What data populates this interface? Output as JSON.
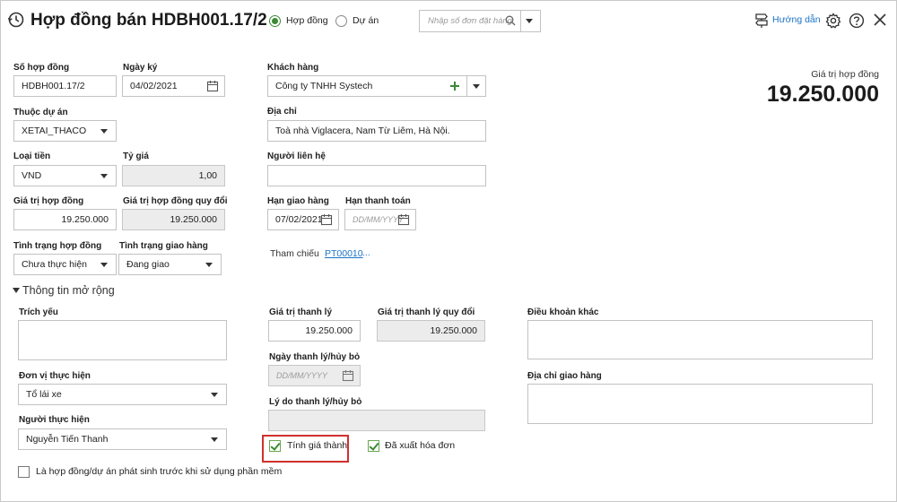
{
  "header": {
    "title": "Hợp đồng bán HDBH001.17/2",
    "radio_contract": "Hợp đồng",
    "radio_project": "Dự án",
    "search_placeholder": "Nhập số đơn đặt hàng",
    "guide_label": "Hướng dẫn"
  },
  "summary": {
    "contract_value_label": "Giá trị hợp đồng",
    "contract_value": "19.250.000"
  },
  "form": {
    "contract_no_label": "Số hợp đồng",
    "contract_no": "HDBH001.17/2",
    "sign_date_label": "Ngày ký",
    "sign_date": "04/02/2021",
    "customer_label": "Khách hàng",
    "customer": "Công ty TNHH Systech",
    "project_label": "Thuộc dự án",
    "project": "XETAI_THACO",
    "address_label": "Địa chỉ",
    "address": "Toà nhà Viglacera, Nam Từ Liêm, Hà Nội.",
    "currency_label": "Loại tiền",
    "currency": "VND",
    "rate_label": "Tỷ giá",
    "rate": "1,00",
    "contact_label": "Người liên hệ",
    "contact": "",
    "value_label": "Giá trị hợp đồng",
    "value": "19.250.000",
    "value_converted_label": "Giá trị hợp đồng quy đổi",
    "value_converted": "19.250.000",
    "delivery_deadline_label": "Hạn giao hàng",
    "delivery_deadline": "07/02/2021",
    "payment_deadline_label": "Hạn thanh toán",
    "payment_deadline_placeholder": "DD/MM/YYYY",
    "status_label": "Tình trạng hợp đồng",
    "status": "Chưa thực hiện",
    "delivery_status_label": "Tình trạng giao hàng",
    "delivery_status": "Đang giao",
    "reference_label": "Tham chiếu",
    "reference_link": "PT00010",
    "reference_more": "..."
  },
  "extended": {
    "section_label": "Thông tin mở rộng",
    "summary_label": "Trích yếu",
    "unit_label": "Đơn vị thực hiện",
    "unit": "Tổ lái xe",
    "performer_label": "Người thực hiện",
    "performer": "Nguyễn Tiến Thanh",
    "legacy_checkbox_label": "Là hợp đồng/dự án phát sinh trước khi sử dụng phần mềm",
    "liquidation_value_label": "Giá trị thanh lý",
    "liquidation_value": "19.250.000",
    "liquidation_converted_label": "Giá trị thanh lý quy đổi",
    "liquidation_converted": "19.250.000",
    "liquidation_date_label": "Ngày thanh lý/hủy bỏ",
    "liquidation_date_placeholder": "DD/MM/YYYY",
    "liquidation_reason_label": "Lý do thanh lý/hủy bỏ",
    "cost_checkbox_label": "Tính giá thành",
    "invoiced_checkbox_label": "Đã xuất hóa đơn",
    "other_terms_label": "Điều khoản khác",
    "delivery_address_label": "Địa chỉ giao hàng"
  },
  "colors": {
    "accent_green": "#3c8a34",
    "link_blue": "#1a73c7",
    "highlight_red": "#d0312d"
  },
  "icons": [
    "history-icon",
    "search-icon",
    "chevron-down-icon",
    "guide-icon",
    "gear-icon",
    "help-icon",
    "close-icon",
    "calendar-icon",
    "plus-icon",
    "triangle-down-icon"
  ]
}
